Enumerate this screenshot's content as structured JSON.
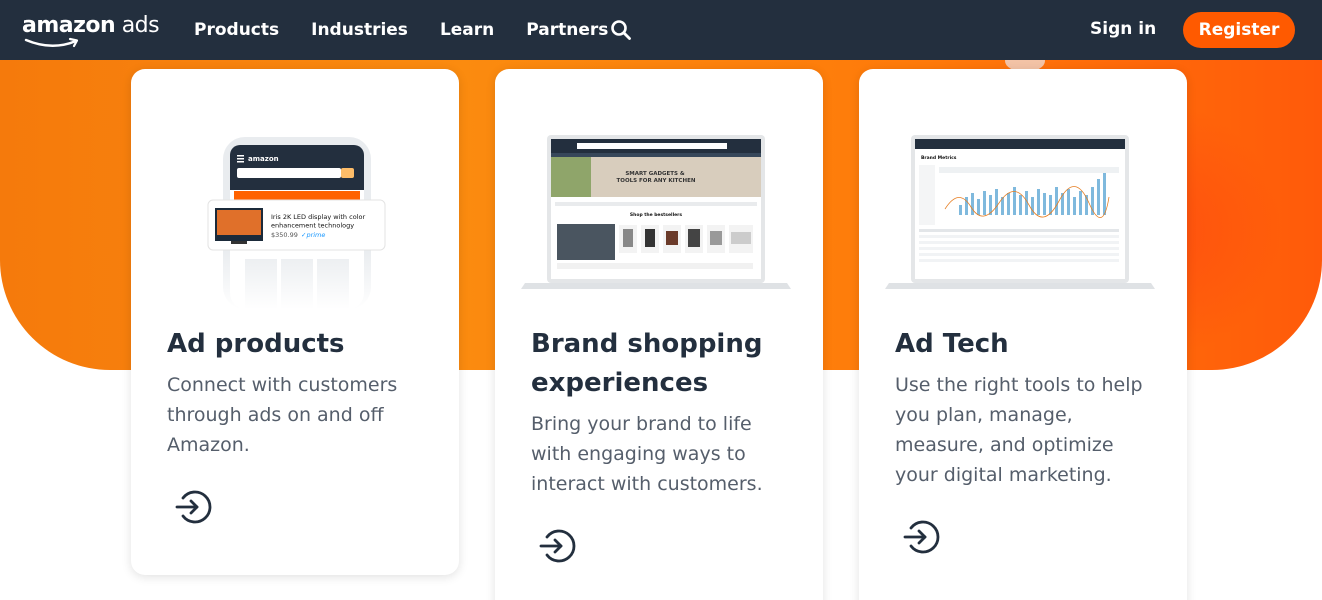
{
  "brand": {
    "logo_word_1": "amazon",
    "logo_word_2": "ads"
  },
  "nav": {
    "links": [
      "Products",
      "Industries",
      "Learn",
      "Partners"
    ],
    "search_icon": "search-icon",
    "sign_in": "Sign in",
    "register": "Register"
  },
  "colors": {
    "nav_bg": "#232f3e",
    "accent": "#ff5a00",
    "hero": "#f98a10"
  },
  "cards": [
    {
      "title": "Ad products",
      "desc": "Connect with customers through ads on and off Amazon.",
      "icon": "arrow-circle-icon",
      "media": {
        "phone_logo": "amazon",
        "product_title": "Iris 2K LED display with color enhancement technology",
        "price": "$350.99",
        "badge": "prime"
      }
    },
    {
      "title": "Brand shopping experiences",
      "desc": "Bring your brand to life with engaging ways to interact with customers.",
      "icon": "arrow-circle-icon",
      "media": {
        "banner": "SMART GADGETS & TOOLS FOR ANY KITCHEN",
        "section": "Shop the bestsellers"
      }
    },
    {
      "title": "Ad Tech",
      "desc": "Use the right tools to help you plan, manage, measure, and optimize your digital marketing.",
      "icon": "arrow-circle-icon",
      "media": {
        "heading": "Brand Metrics"
      }
    }
  ]
}
